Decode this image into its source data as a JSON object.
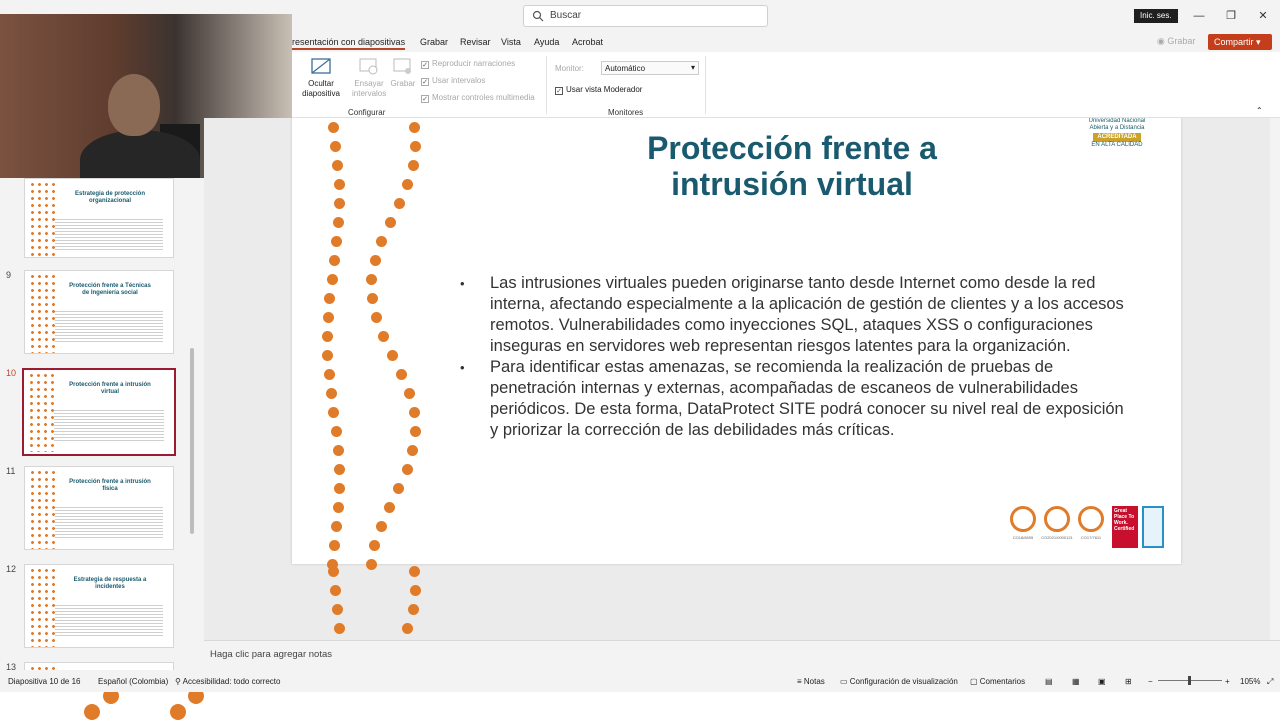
{
  "search": {
    "placeholder": "Buscar"
  },
  "account": {
    "signin": "Inic. ses."
  },
  "window_controls": {
    "minimize": "—",
    "maximize": "❐",
    "close": "✕"
  },
  "ribbon_tabs": [
    {
      "label": "resentación con diapositivas",
      "active": true
    },
    {
      "label": "Grabar"
    },
    {
      "label": "Revisar"
    },
    {
      "label": "Vista"
    },
    {
      "label": "Ayuda"
    },
    {
      "label": "Acrobat"
    }
  ],
  "record_button": "Grabar",
  "share_button": "Compartir",
  "ribbon": {
    "hide_slide": "Ocultar diapositiva",
    "rehearse": "Ensayar intervalos",
    "record": "Grabar",
    "chk_narrations": "Reproducir narraciones",
    "chk_timings": "Usar intervalos",
    "chk_media": "Mostrar controles multimedia",
    "group_configure": "Configurar",
    "monitor_label": "Monitor:",
    "monitor_value": "Automático",
    "presenter_view": "Usar vista Moderador",
    "group_monitors": "Monitores"
  },
  "thumbnails": [
    {
      "num": "",
      "title": "Estrategia de protección organizacional"
    },
    {
      "num": "9",
      "title": "Protección frente a Técnicas de Ingeniería social"
    },
    {
      "num": "10",
      "title": "Protección frente a intrusión virtual",
      "selected": true
    },
    {
      "num": "11",
      "title": "Protección frente a intrusión física"
    },
    {
      "num": "12",
      "title": "Estrategia de respuesta a incidentes"
    },
    {
      "num": "13",
      "title": ""
    }
  ],
  "slide": {
    "title": "Protección frente a intrusión virtual",
    "bullets": [
      "Las intrusiones virtuales pueden originarse tanto desde Internet como desde la red interna, afectando especialmente a la aplicación de gestión de clientes y a los accesos remotos. Vulnerabilidades como inyecciones SQL, ataques XSS o configuraciones inseguras en servidores web representan riesgos latentes para la organización.",
      "Para identificar estas amenazas, se recomienda la realización de pruebas de penetración internas y externas, acompañadas de escaneos de vulnerabilidades periódicos. De esta forma, DataProtect SITE podrá conocer su nivel real de exposición y priorizar la corrección de las debilidades más críticas."
    ],
    "logo_line1": "Universidad Nacional",
    "logo_line2": "Abierta y a Distancia",
    "logo_badge": "ACREDITADA",
    "logo_line3": "EN ALTA CALIDAD",
    "cert1": "CO18/6655",
    "cert2": "CO2021/0000121",
    "cert3": "CO17/7611",
    "gptw": "Great Place To Work. Certified"
  },
  "notes_placeholder": "Haga clic para agregar notas",
  "status": {
    "slide_counter": "Diapositiva 10 de 16",
    "language": "Español (Colombia)",
    "accessibility": "Accesibilidad: todo correcto",
    "notes": "Notas",
    "display_settings": "Configuración de visualización",
    "comments": "Comentarios",
    "zoom": "105%"
  }
}
